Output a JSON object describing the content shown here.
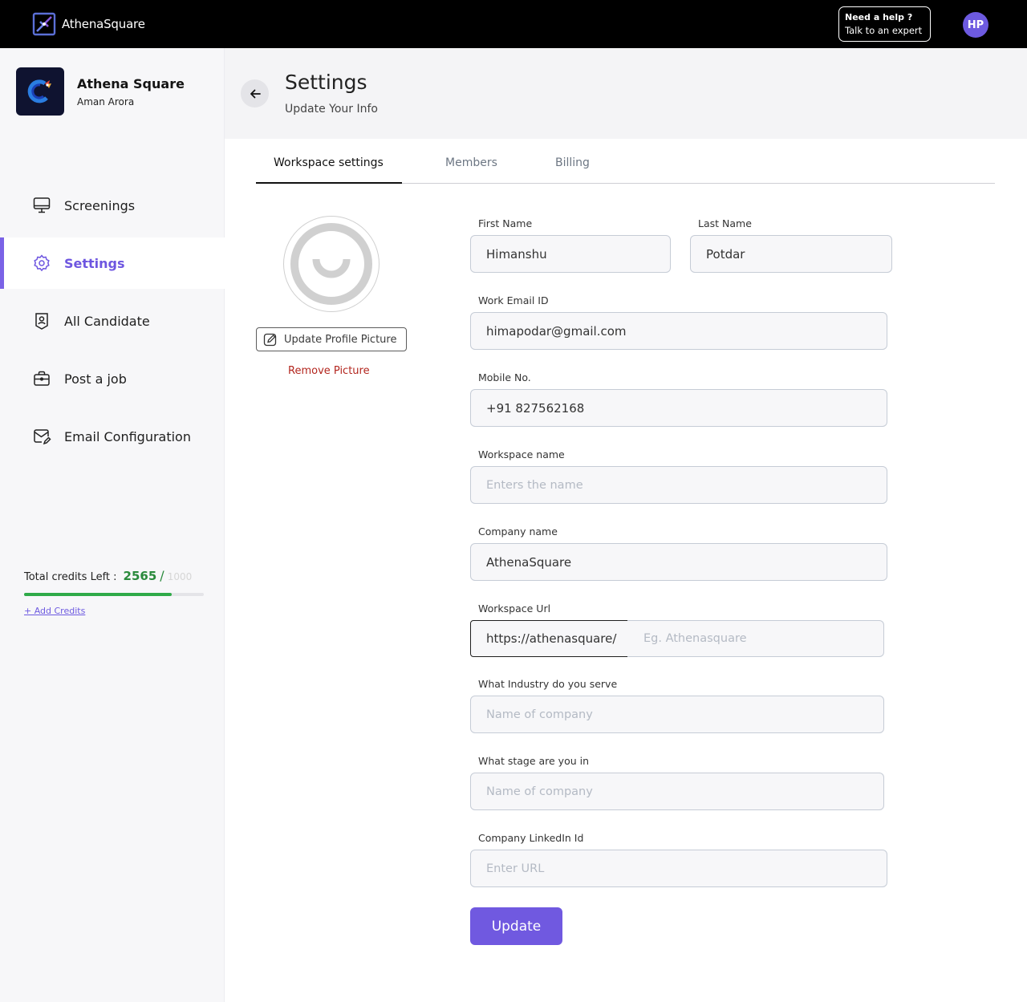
{
  "brand": {
    "name": "AthenaSquare"
  },
  "header": {
    "help_title": "Need a help ?",
    "help_sub": "Talk to an expert",
    "avatar_initials": "HP"
  },
  "sidebar": {
    "org_name": "Athena Square",
    "org_user": "Aman Arora",
    "items": [
      {
        "label": "Screenings",
        "icon": "monitor-icon"
      },
      {
        "label": "Settings",
        "icon": "gear-icon",
        "active": true
      },
      {
        "label": "All Candidate",
        "icon": "user-badge-icon"
      },
      {
        "label": "Post a job",
        "icon": "briefcase-icon"
      },
      {
        "label": "Email Configuration",
        "icon": "mail-edit-icon"
      }
    ],
    "credits": {
      "label": "Total credits Left :",
      "value": "2565",
      "slash": "/",
      "total": "1000",
      "progress_fraction": 0.82,
      "add_label": "+ Add Credits"
    }
  },
  "page": {
    "title": "Settings",
    "subtitle": "Update Your Info"
  },
  "tabs": [
    {
      "label": "Workspace settings",
      "active": true
    },
    {
      "label": "Members"
    },
    {
      "label": "Billing"
    }
  ],
  "profile": {
    "update_label": "Update Profile Picture",
    "remove_label": "Remove Picture"
  },
  "form": {
    "first_name": {
      "label": "First Name",
      "value": "Himanshu"
    },
    "last_name": {
      "label": "Last Name",
      "value": "Potdar"
    },
    "email": {
      "label": "Work Email ID",
      "value": "himapodar@gmail.com"
    },
    "mobile": {
      "label": "Mobile No.",
      "value": "+91 827562168"
    },
    "workspace_name": {
      "label": "Workspace name",
      "placeholder": "Enters the name"
    },
    "company_name": {
      "label": "Company name",
      "value": "AthenaSquare"
    },
    "workspace_url": {
      "label": "Workspace Url",
      "prefix": "https://athenasquare/",
      "placeholder": "Eg. Athenasquare"
    },
    "industry": {
      "label": "What Industry do you serve",
      "placeholder": "Name of company"
    },
    "stage": {
      "label": "What stage are you in",
      "placeholder": "Name of company"
    },
    "linkedin": {
      "label": "Company LinkedIn Id",
      "placeholder": "Enter URL"
    },
    "submit_label": "Update"
  },
  "colors": {
    "accent": "#7059e0",
    "credits_green": "#2faa48",
    "danger": "#b3261e"
  }
}
